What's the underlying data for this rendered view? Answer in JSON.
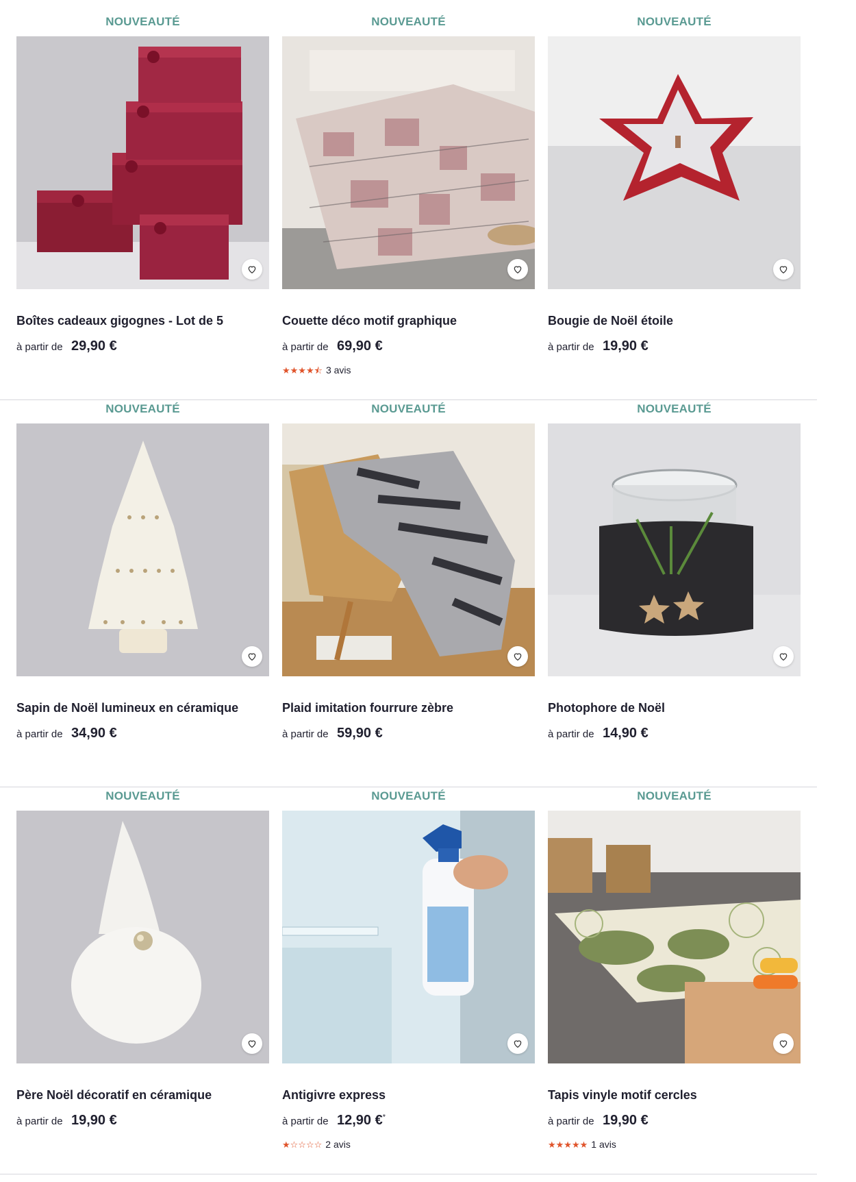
{
  "products": [
    {
      "badge": "NOUVEAUTÉ",
      "title": "Boîtes cadeaux gigognes - Lot de 5",
      "from": "à partir de",
      "price": "29,90 €",
      "rating": null,
      "image": "red-gift-boxes"
    },
    {
      "badge": "NOUVEAUTÉ",
      "title": "Couette déco motif graphique",
      "from": "à partir de",
      "price": "69,90 €",
      "rating": {
        "stars": "★★★★⯪",
        "text": "3 avis"
      },
      "image": "patterned-duvet"
    },
    {
      "badge": "NOUVEAUTÉ",
      "title": "Bougie de Noël étoile",
      "from": "à partir de",
      "price": "19,90 €",
      "rating": null,
      "image": "star-candle"
    },
    {
      "badge": "NOUVEAUTÉ",
      "title": "Sapin de Noël lumineux en céramique",
      "from": "à partir de",
      "price": "34,90 €",
      "rating": null,
      "image": "ceramic-tree"
    },
    {
      "badge": "NOUVEAUTÉ",
      "title": "Plaid imitation fourrure zèbre",
      "from": "à partir de",
      "price": "59,90 €",
      "rating": null,
      "image": "zebra-throw-chair"
    },
    {
      "badge": "NOUVEAUTÉ",
      "title": "Photophore de Noël",
      "from": "à partir de",
      "price": "14,90 €",
      "rating": null,
      "image": "fur-candle-holder"
    },
    {
      "badge": "NOUVEAUTÉ",
      "title": "Père Noël décoratif en céramique",
      "from": "à partir de",
      "price": "19,90 €",
      "rating": null,
      "image": "ceramic-gnome"
    },
    {
      "badge": "NOUVEAUTÉ",
      "title": "Antigivre express",
      "from": "à partir de",
      "price": "12,90 €",
      "price_sup": "*",
      "rating": {
        "stars": "★☆☆☆☆",
        "text": "2 avis"
      },
      "image": "defrost-spray"
    },
    {
      "badge": "NOUVEAUTÉ",
      "title": "Tapis vinyle motif cercles",
      "from": "à partir de",
      "price": "19,90 €",
      "rating": {
        "stars": "★★★★★",
        "text": "1 avis"
      },
      "image": "circle-vinyl-rug"
    }
  ],
  "colors": {
    "badge": "#5a9a92",
    "stars": "#e0542b",
    "text": "#1f1f2e"
  },
  "icons": {
    "favorite": "heart-outline-icon"
  }
}
